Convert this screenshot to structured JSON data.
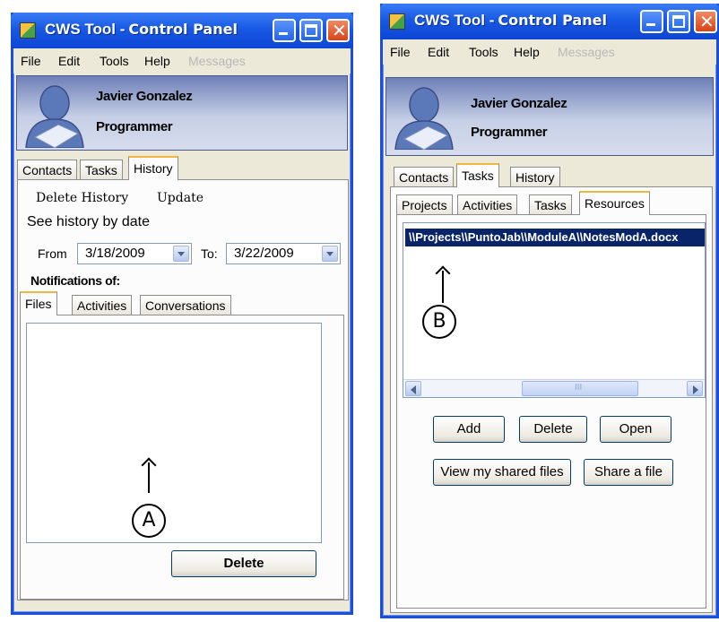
{
  "colors": {
    "titlebar": "#1859e4",
    "selection": "#0a246a",
    "tab_active_accent": "#f1b63e",
    "window_bg": "#ece9d8"
  },
  "window_a": {
    "title_prefix": "CWS Tool -",
    "title_main": "Control Panel",
    "controls": {
      "minimize_icon": "minimize-icon",
      "maximize_icon": "maximize-icon",
      "close_icon": "close-icon"
    },
    "menu": {
      "file": "File",
      "edit": "Edit",
      "tools": "Tools",
      "help": "Help",
      "messages": "Messages"
    },
    "user": {
      "name": "Javier Gonzalez",
      "role": "Programmer"
    },
    "tabs": {
      "contacts": "Contacts",
      "tasks": "Tasks",
      "history": "History"
    },
    "history": {
      "delete_history": "Delete History",
      "update": "Update",
      "heading": "See history by date",
      "from_label": "From",
      "from_value": "3/18/2009",
      "to_label": "To:",
      "to_value": "3/22/2009",
      "notifications_label": "Notifications of:",
      "sub_tabs": {
        "files": "Files",
        "activities": "Activities",
        "conversations": "Conversations"
      },
      "delete_button": "Delete"
    },
    "annotation": "A"
  },
  "window_b": {
    "title_prefix": "CWS Tool -",
    "title_main": "Control Panel",
    "controls": {
      "minimize_icon": "minimize-icon",
      "maximize_icon": "maximize-icon",
      "close_icon": "close-icon"
    },
    "menu": {
      "file": "File",
      "edit": "Edit",
      "tools": "Tools",
      "help": "Help",
      "messages": "Messages"
    },
    "user": {
      "name": "Javier Gonzalez",
      "role": "Programmer"
    },
    "tabs": {
      "contacts": "Contacts",
      "tasks": "Tasks",
      "history": "History"
    },
    "task_tabs": {
      "projects": "Projects",
      "activities": "Activities",
      "tasks": "Tasks",
      "resources": "Resources"
    },
    "resources": {
      "selected_item": "\\\\Projects\\\\PuntoJab\\\\ModuleA\\\\NotesModA.docx",
      "scrollbar_grip": "III",
      "buttons": {
        "add": "Add",
        "delete": "Delete",
        "open": "Open",
        "view_shared": "View my shared files",
        "share": "Share a file"
      }
    },
    "annotation": "B"
  }
}
